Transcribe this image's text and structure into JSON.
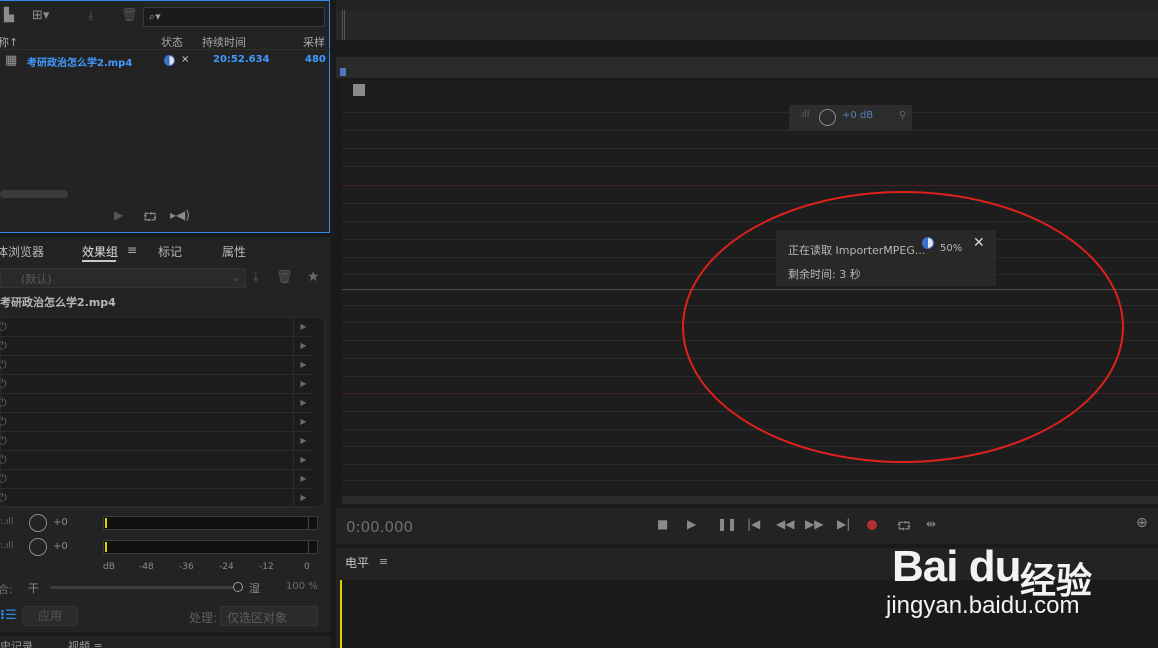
{
  "files_panel": {
    "search_placeholder": "⌕▾",
    "columns": {
      "name": "称↑",
      "status": "状态",
      "duration": "持续时间",
      "sample": "采样"
    },
    "file": {
      "name": "考研政治怎么学2.mp4",
      "status_close": "×",
      "duration": "20:52.634",
      "sample": "480"
    }
  },
  "effects_panel": {
    "tabs": [
      "体浏览器",
      "效果组",
      "标记",
      "属性"
    ],
    "active_tab": "效果组",
    "preset": "(默认)",
    "clip_title": "考研政治怎么学2.mp4",
    "slot_count": 10,
    "input_gain": "+0",
    "output_gain": "+0",
    "db_scale": [
      "dB",
      "-48",
      "-36",
      "-24",
      "-12",
      "0"
    ],
    "mix_dry": "干",
    "mix_wet": "湿",
    "mix_value": "100 %",
    "apply_label": "应用",
    "process_label": "处理:",
    "process_value": "仅选区对象"
  },
  "editor": {
    "hud_gain": "+0 dB",
    "timecode": "0:00.000"
  },
  "progress_toast": {
    "message": "正在读取 ImporterMPEG...",
    "percent": "50%",
    "progress": 0.5,
    "remaining": "剩余时间: 3 秒",
    "close": "✕"
  },
  "level_panel": {
    "title": "电平"
  },
  "watermark": {
    "brand": "Bai du",
    "suffix": "经验",
    "url": "jingyan.baidu.com"
  },
  "colors": {
    "accent": "#2d8ceb",
    "link": "#3f9bff",
    "annotation": "#e0201b",
    "meter_peak": "#d8d000"
  }
}
